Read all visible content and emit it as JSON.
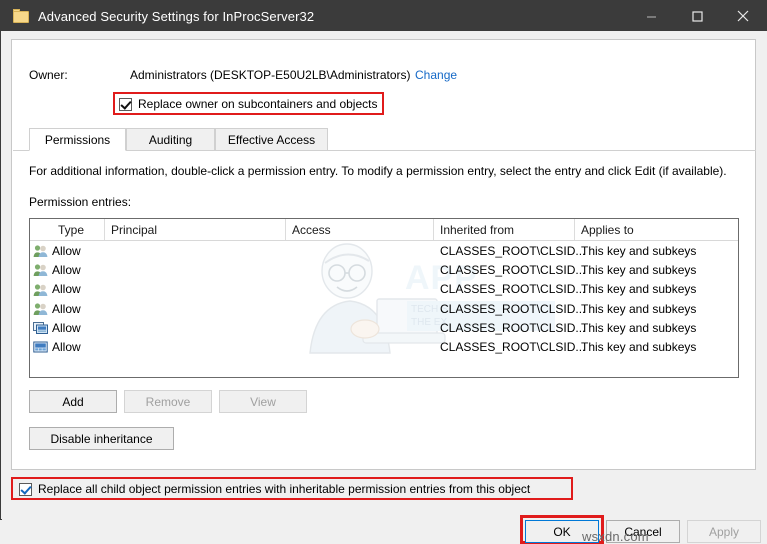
{
  "window": {
    "title": "Advanced Security Settings for InProcServer32",
    "icon": "folder-icon",
    "controls": {
      "minimize": "minimize-icon",
      "maximize": "maximize-icon",
      "close": "close-icon"
    }
  },
  "owner": {
    "label": "Owner:",
    "value": "Administrators (DESKTOP-E50U2LB\\Administrators)",
    "change_link": "Change",
    "replace_owner_checkbox": {
      "label": "Replace owner on subcontainers and objects",
      "checked": true,
      "highlighted": true
    }
  },
  "tabs": [
    {
      "label": "Permissions",
      "active": true
    },
    {
      "label": "Auditing",
      "active": false
    },
    {
      "label": "Effective Access",
      "active": false
    }
  ],
  "main": {
    "info_text": "For additional information, double-click a permission entry. To modify a permission entry, select the entry and click Edit (if available).",
    "entries_label": "Permission entries:"
  },
  "table": {
    "columns": [
      "Type",
      "Principal",
      "Access",
      "Inherited from",
      "Applies to"
    ],
    "rows": [
      {
        "icon": "users-icon",
        "type": "Allow",
        "principal": "",
        "access": "",
        "inherited_from": "CLASSES_ROOT\\CLSID...",
        "applies_to": "This key and subkeys"
      },
      {
        "icon": "users-icon",
        "type": "Allow",
        "principal": "",
        "access": "",
        "inherited_from": "CLASSES_ROOT\\CLSID...",
        "applies_to": "This key and subkeys"
      },
      {
        "icon": "users-icon",
        "type": "Allow",
        "principal": "",
        "access": "",
        "inherited_from": "CLASSES_ROOT\\CLSID...",
        "applies_to": "This key and subkeys"
      },
      {
        "icon": "users-icon",
        "type": "Allow",
        "principal": "",
        "access": "",
        "inherited_from": "CLASSES_ROOT\\CLSID...",
        "applies_to": "This key and subkeys"
      },
      {
        "icon": "computer-icon",
        "type": "Allow",
        "principal": "",
        "access": "",
        "inherited_from": "CLASSES_ROOT\\CLSID...",
        "applies_to": "This key and subkeys"
      },
      {
        "icon": "monitor-icon",
        "type": "Allow",
        "principal": "",
        "access": "",
        "inherited_from": "CLASSES_ROOT\\CLSID...",
        "applies_to": "This key and subkeys"
      }
    ]
  },
  "buttons": {
    "add": "Add",
    "remove": "Remove",
    "view": "View",
    "disable_inheritance": "Disable inheritance",
    "ok": "OK",
    "cancel": "Cancel",
    "apply": "Apply"
  },
  "replace_child_checkbox": {
    "label": "Replace all child object permission entries with inheritable permission entries from this object",
    "checked": true,
    "highlighted": true
  },
  "watermark": {
    "overlay_text": "APP",
    "tagline_line1": "TECH S",
    "tagline_line2": "THE EX",
    "site": "wsxdn.com"
  },
  "colors": {
    "titlebar": "#3b3b3b",
    "dialog": "#f0f0f0",
    "link": "#1569c7",
    "highlight": "#e01b1b",
    "focus": "#0078d7"
  }
}
